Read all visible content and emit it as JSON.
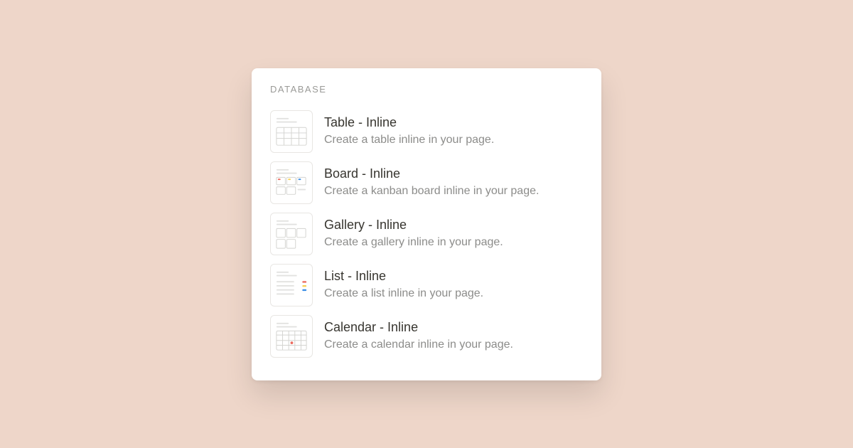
{
  "section_header": "DATABASE",
  "items": [
    {
      "key": "table",
      "title": "Table - Inline",
      "desc": "Create a table inline in your page."
    },
    {
      "key": "board",
      "title": "Board - Inline",
      "desc": "Create a kanban board inline in your page."
    },
    {
      "key": "gallery",
      "title": "Gallery - Inline",
      "desc": "Create a gallery inline in your page."
    },
    {
      "key": "list",
      "title": "List - Inline",
      "desc": "Create a list inline in your page."
    },
    {
      "key": "calendar",
      "title": "Calendar - Inline",
      "desc": "Create a calendar inline in your page."
    }
  ],
  "accent_colors": {
    "red": "#ec6b5f",
    "yellow": "#f7d154",
    "blue": "#3b8ee6"
  }
}
